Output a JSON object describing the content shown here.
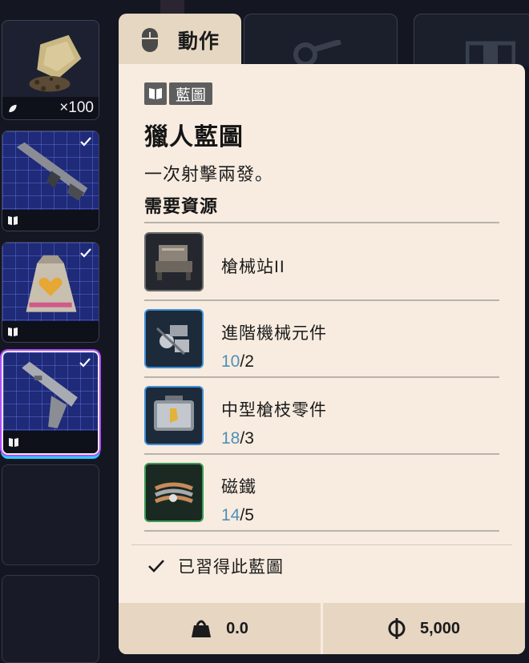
{
  "inventory": {
    "slots": [
      {
        "item": "seed-bag",
        "quantity": "×100",
        "type_icon": "leaf-icon"
      },
      {
        "item": "rifle",
        "type_icon": "blueprint-book-icon",
        "checked": true
      },
      {
        "item": "heart-container",
        "type_icon": "blueprint-book-icon",
        "checked": true
      },
      {
        "item": "pistol",
        "type_icon": "blueprint-book-icon",
        "checked": true,
        "selected": true
      },
      {
        "item": "empty"
      },
      {
        "item": "empty"
      }
    ]
  },
  "tabs": [
    {
      "label": "動作",
      "icon": "mouse-icon",
      "active": true
    },
    {
      "label": "",
      "icon": "key-icon",
      "active": false
    },
    {
      "label": "",
      "icon": "building-icon",
      "active": false
    }
  ],
  "tooltip": {
    "category": "藍圖",
    "title": "獵人藍圖",
    "description": "一次射擊兩發。",
    "requirements_heading": "需要資源",
    "resources": [
      {
        "name": "槍械站II",
        "have": "",
        "need": "",
        "count_visible": false,
        "rarity_color": "#6a6a6a"
      },
      {
        "name": "進階機械元件",
        "have": "10",
        "need": "/2",
        "count_visible": true,
        "rarity_color": "#3e8ed8"
      },
      {
        "name": "中型槍枝零件",
        "have": "18",
        "need": "/3",
        "count_visible": true,
        "rarity_color": "#3e8ed8"
      },
      {
        "name": "磁鐵",
        "have": "14",
        "need": "/5",
        "count_visible": true,
        "rarity_color": "#3c9a56"
      }
    ],
    "learned_text": "已習得此藍圖",
    "footer": {
      "weight": "0.0",
      "price": "5,000"
    }
  },
  "colors": {
    "panel_bg": "#f8ece0",
    "accent_count": "#4f8fb9",
    "tab_active": "#e6d7c3"
  }
}
